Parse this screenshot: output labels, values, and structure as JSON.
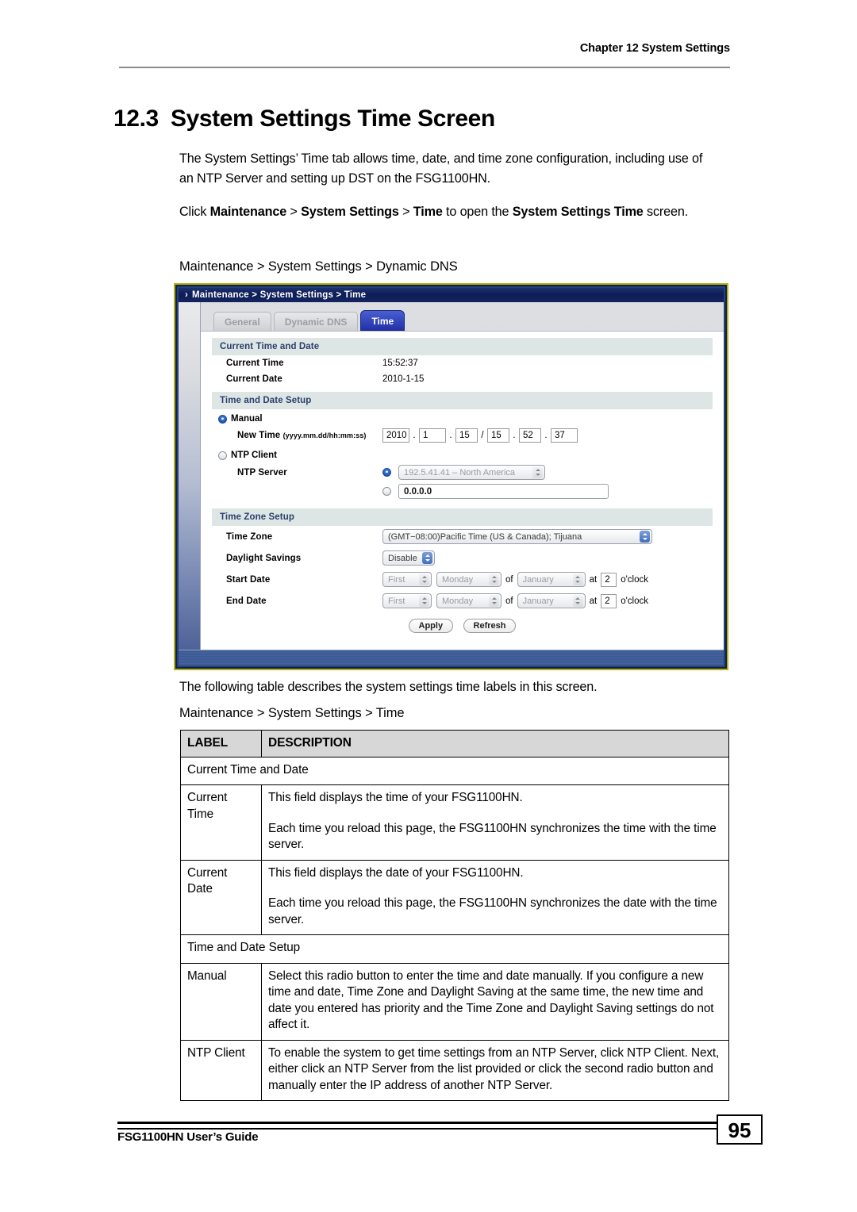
{
  "header": {
    "chapter": "Chapter 12 System Settings"
  },
  "section": {
    "number": "12.3",
    "title": "System Settings Time Screen"
  },
  "paragraphs": {
    "intro": "The System Settings’ Time tab allows time, date, and time zone configuration, including use of an NTP Server and setting up DST on the FSG1100HN.",
    "click_prefix": "Click ",
    "click_b1": "Maintenance",
    "click_sep1": " > ",
    "click_b2": "System Settings",
    "click_sep2": " > ",
    "click_b3": "Time",
    "click_mid": " to open the ",
    "click_b4": "System Settings Time",
    "click_end": " screen.",
    "after_figure": "The following table describes the system settings time labels in this screen."
  },
  "figure": {
    "caption": "Maintenance > System Settings > Dynamic DNS",
    "titlebar_arrow": "›",
    "titlebar": "Maintenance > System Settings > Time",
    "tabs": [
      {
        "label": "General",
        "active": false
      },
      {
        "label": "Dynamic DNS",
        "active": false
      },
      {
        "label": "Time",
        "active": true
      }
    ],
    "section_current": "Current Time and Date",
    "current_time_label": "Current Time",
    "current_time_value": "15:52:37",
    "current_date_label": "Current Date",
    "current_date_value": "2010-1-15",
    "section_setup": "Time and Date Setup",
    "manual_label": "Manual",
    "new_time_label": "New Time",
    "new_time_format": "(yyyy.mm.dd/hh:mm:ss)",
    "new_time": {
      "year": "2010",
      "month": "1",
      "day": "15",
      "hour": "15",
      "minute": "52",
      "second": "37",
      "dot1": ".",
      "dot2": ".",
      "slash": "/",
      "dot3": ".",
      "dot4": "."
    },
    "ntp_client_label": "NTP Client",
    "ntp_server_label": "NTP Server",
    "ntp_server_select": "192.5.41.41 – North America",
    "ntp_server_ip": "0.0.0.0",
    "section_timezone": "Time Zone Setup",
    "time_zone_label": "Time Zone",
    "time_zone_value": "(GMT−08:00)Pacific Time (US & Canada); Tijuana",
    "daylight_label": "Daylight Savings",
    "daylight_value": "Disable",
    "start_date_label": "Start Date",
    "end_date_label": "End Date",
    "dst_row": {
      "ordinal": "First",
      "weekday": "Monday",
      "of": "of",
      "month": "January",
      "at": "at",
      "hour": "2",
      "oclock": "o'clock"
    },
    "apply_button": "Apply",
    "refresh_button": "Refresh"
  },
  "table": {
    "caption": "Maintenance > System Settings > Time",
    "headers": {
      "label": "LABEL",
      "description": "DESCRIPTION"
    },
    "group1": "Current Time and Date",
    "rows": [
      {
        "label": "Current Time",
        "p1": "This field displays the time of your FSG1100HN.",
        "p2": "Each time you reload this page, the FSG1100HN synchronizes the time with the time server."
      },
      {
        "label": "Current Date",
        "p1": "This field displays the date of your FSG1100HN.",
        "p2": "Each time you reload this page, the FSG1100HN synchronizes the date with the time server."
      }
    ],
    "group2": "Time and Date Setup",
    "rows2": [
      {
        "label": "Manual",
        "p1": "Select this radio button to enter the time and date manually. If you configure a new time and date, Time Zone and Daylight Saving at the same time, the new time and date you entered has priority and the Time Zone and Daylight Saving settings do not affect it."
      },
      {
        "label": "NTP Client",
        "p1": "To enable the system to get time settings from an NTP Server, click NTP Client. Next, either click an NTP Server from the list provided or click the second radio button and manually enter the IP address of another NTP Server."
      }
    ]
  },
  "footer": {
    "guide": "FSG1100HN User’s Guide",
    "page": "95"
  },
  "colors": {
    "tab_active": "#2331a8",
    "frame_border": "#b7b200",
    "titlebar": "#0d1d55",
    "section_bar": "#dde6e5"
  }
}
